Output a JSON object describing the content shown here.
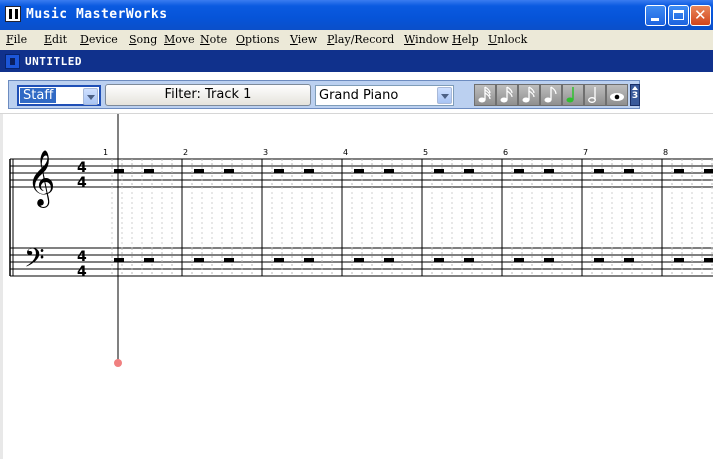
{
  "window": {
    "title": "Music MasterWorks"
  },
  "menu": [
    "File",
    "Edit",
    "Device",
    "Song",
    "Move",
    "Note",
    "Options",
    "View",
    "Play/Record",
    "Window",
    "Help",
    "Unlock"
  ],
  "document": {
    "title": "UNTITLED"
  },
  "toolbar": {
    "view_mode": "Staff",
    "filter_label": "Filter: Track 1",
    "instrument": "Grand Piano",
    "note_buttons": [
      "sixty-fourth-note",
      "thirty-second-note",
      "sixteenth-note",
      "eighth-note",
      "quarter-note",
      "half-note",
      "eye-icon"
    ],
    "selected_note": "quarter-note",
    "selected_color": "#2fbf2f",
    "spinner_value": "3"
  },
  "score": {
    "time_signature": {
      "top": "4",
      "bottom": "4"
    },
    "measure_numbers": [
      "1",
      "2",
      "3",
      "4",
      "5",
      "6",
      "7",
      "8"
    ],
    "clefs": [
      "treble-clef",
      "bass-clef"
    ],
    "cursor_color": "#f08080"
  }
}
